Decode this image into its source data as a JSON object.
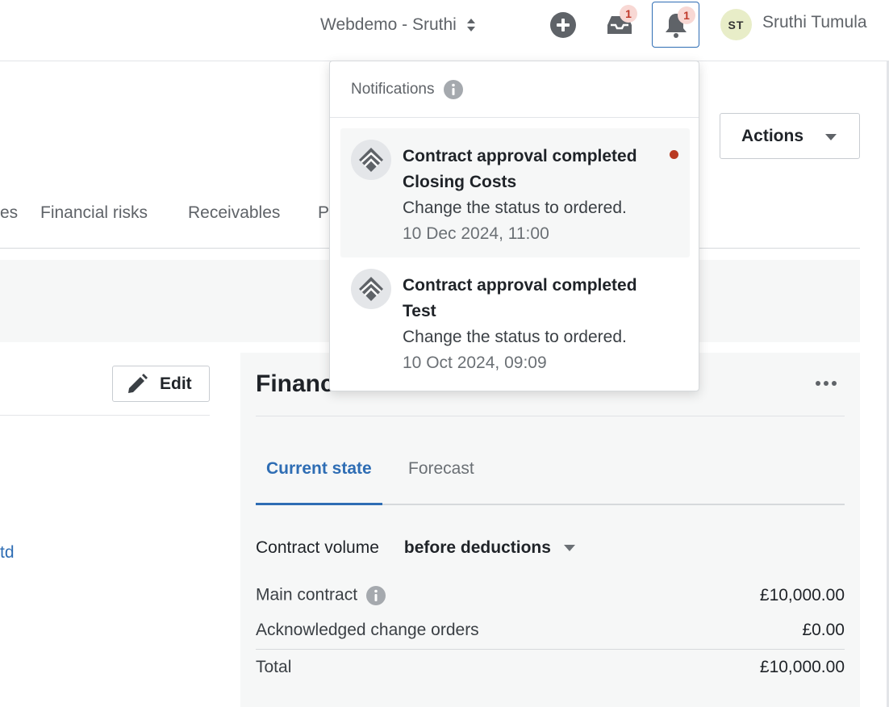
{
  "topbar": {
    "workspace": "Webdemo - Sruthi",
    "inbox_badge": "1",
    "bell_badge": "1",
    "avatar_initials": "ST",
    "user_name": "Sruthi Tumula"
  },
  "page": {
    "actions_label": "Actions",
    "tabs": [
      "es",
      "Financial risks",
      "Receivables",
      "P"
    ],
    "edit_label": "Edit",
    "left_link": "td"
  },
  "finance": {
    "title_partial": "Financ",
    "tabs": [
      "Current state",
      "Forecast"
    ],
    "active_tab": "Current state",
    "volume_label": "Contract volume",
    "volume_select": "before deductions",
    "rows": [
      {
        "label": "Main contract",
        "value": "£10,000.00"
      },
      {
        "label": "Acknowledged change orders",
        "value": "£0.00"
      },
      {
        "label": "Total",
        "value": "£10,000.00"
      }
    ]
  },
  "notifications": {
    "header": "Notifications",
    "items": [
      {
        "title": "Contract approval completed",
        "subject": "Closing Costs",
        "message": "Change the status to ordered.",
        "time": "10 Dec 2024, 11:00",
        "unread": true
      },
      {
        "title": "Contract approval completed",
        "subject": "Test",
        "message": "Change the status to ordered.",
        "time": "10 Oct 2024, 09:09",
        "unread": false
      }
    ]
  },
  "colors": {
    "accent": "#2e6db4",
    "unread_dot": "#b93a22",
    "badge_bg": "#f8d8d4",
    "badge_text": "#c0392b"
  }
}
